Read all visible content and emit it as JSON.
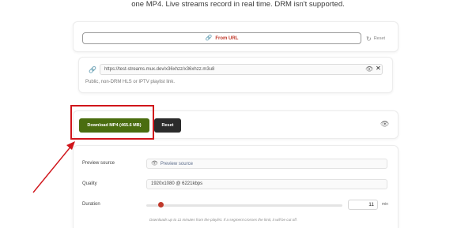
{
  "intro_text": "one MP4. Live streams record in real time. DRM isn't supported.",
  "source": {
    "from_url_label": "From URL",
    "reset_label": "Reset"
  },
  "url_input": {
    "value": "https://test-streams.mux.dev/x36xhzz/x36xhzz.m3u8",
    "help": "Public, non-DRM HLS or IPTV playlist link."
  },
  "actions": {
    "download_label": "Download MP4 (465.6 MB)",
    "reset_label": "Reset"
  },
  "settings": {
    "preview_label": "Preview source",
    "preview_value": "Preview source",
    "quality_label": "Quality",
    "quality_value": "1920x1080 @ 6221kbps",
    "duration_label": "Duration",
    "duration_value": "11",
    "duration_unit": "min",
    "duration_help": "Downloads up to 11 minutes from the playlist. If a segment crosses the limit, it will be cut off."
  },
  "colors": {
    "accent": "#c0392b",
    "download_button": "#4a6d0f",
    "reset_button": "#2b2b2b",
    "highlight": "#d0151b"
  },
  "icons": {
    "from_url": "link-icon",
    "reset": "refresh-icon",
    "url": "link-icon",
    "show": "eye-icon",
    "clear": "close-icon"
  }
}
